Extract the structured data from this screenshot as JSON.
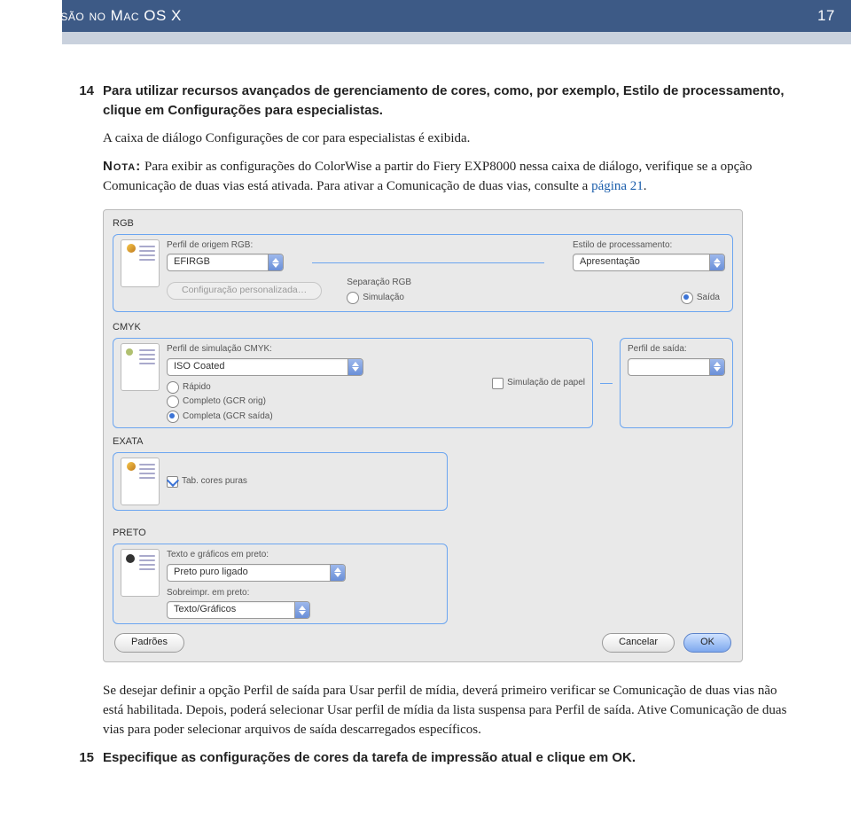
{
  "header": {
    "title": "Impressão no Mac OS X",
    "page_number": "17"
  },
  "step14": {
    "num": "14",
    "text": "Para utilizar recursos avançados de gerenciamento de cores, como, por exemplo, Estilo de processamento, clique em Configurações para especialistas."
  },
  "followup_text": "A caixa de diálogo Configurações de cor para especialistas é exibida.",
  "note": {
    "label": "Nota:",
    "text_before": "Para exibir as configurações do ColorWise a partir do Fiery EXP8000 nessa caixa de diálogo, verifique se a opção Comunicação de duas vias está ativada. Para ativar a Comunicação de duas vias, consulte a ",
    "link_text": "página 21",
    "text_after": "."
  },
  "dialog": {
    "rgb": {
      "tag": "RGB",
      "src_label": "Perfil de origem RGB:",
      "src_value": "EFIRGB",
      "style_label": "Estilo de processamento:",
      "style_value": "Apresentação",
      "custom_btn": "Configuração personalizada…",
      "sep_label": "Separação RGB",
      "sep_sim": "Simulação",
      "sep_out": "Saída"
    },
    "cmyk": {
      "tag": "CMYK",
      "sim_label": "Perfil de simulação CMYK:",
      "sim_value": "ISO Coated",
      "r1": "Rápido",
      "r2": "Completo (GCR orig)",
      "r3": "Completa (GCR saída)",
      "paper_sim": "Simulação de papel",
      "out_label": "Perfil de saída:"
    },
    "exata": {
      "tag": "EXATA",
      "chk_label": "Tab. cores puras"
    },
    "preto": {
      "tag": "PRETO",
      "txt_label": "Texto e gráficos em preto:",
      "txt_value": "Preto puro ligado",
      "ovr_label": "Sobreimpr. em preto:",
      "ovr_value": "Texto/Gráficos"
    },
    "buttons": {
      "defaults": "Padrões",
      "cancel": "Cancelar",
      "ok": "OK"
    }
  },
  "followup2": "Se desejar definir a opção Perfil de saída para Usar perfil de mídia, deverá primeiro verificar se Comunicação de duas vias não está habilitada. Depois, poderá selecionar Usar perfil de mídia da lista suspensa para Perfil de saída. Ative Comunicação de duas vias para poder selecionar arquivos de saída descarregados específicos.",
  "step15": {
    "num": "15",
    "text": "Especifique as configurações de cores da tarefa de impressão atual e clique em OK."
  }
}
